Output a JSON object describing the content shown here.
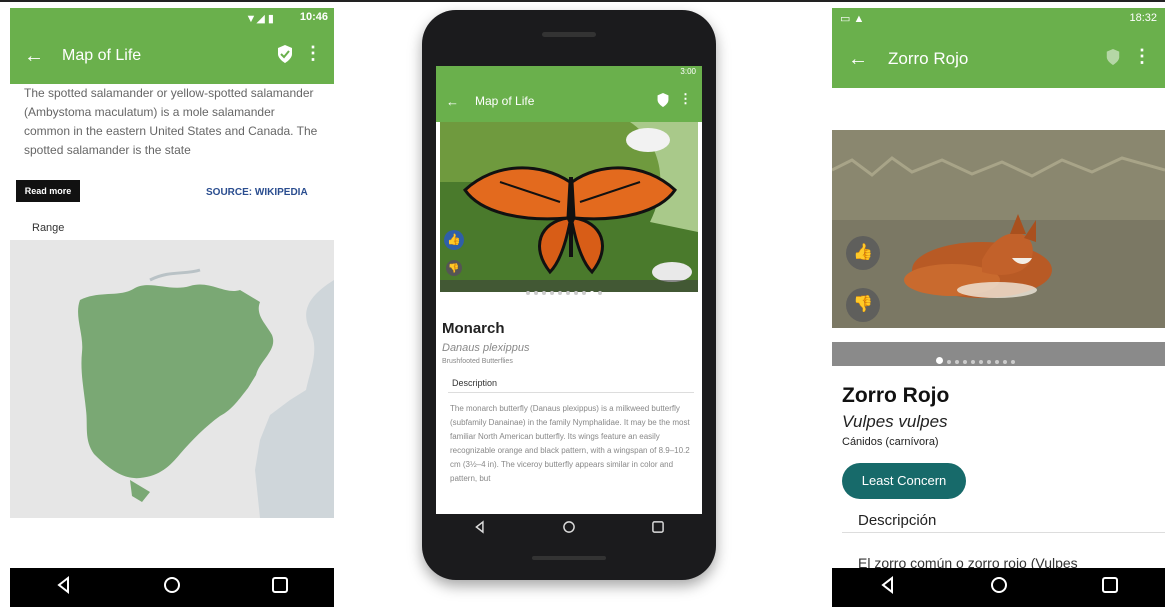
{
  "colors": {
    "green": "#6ab04c",
    "teal": "#176a6a",
    "map_land": "#e3e3e3",
    "map_water": "#cfd6da",
    "range": "#7aa874"
  },
  "left": {
    "status_time": "10:46",
    "title": "Map of Life",
    "description": "The spotted salamander or yellow-spotted salamander (Ambystoma maculatum) is a mole salamander common in the eastern United States and Canada. The spotted salamander is the state",
    "read_more": "Read more",
    "source": "SOURCE: WIKIPEDIA",
    "range_label": "Range",
    "icons": [
      "back-arrow-icon",
      "shield-check-icon",
      "more-vert-icon",
      "nav-back-icon",
      "nav-home-icon",
      "nav-recents-icon"
    ]
  },
  "middle": {
    "status_time": "3:00",
    "title": "Map of Life",
    "species_name": "Monarch",
    "scientific_name": "Danaus plexippus",
    "family": "Brushfooted Butterflies",
    "description_heading": "Description",
    "description": "The monarch butterfly (Danaus plexippus) is a milkweed butterfly (subfamily Danainae) in the family Nymphalidae. It may be the most familiar North American butterfly. Its wings feature an easily recognizable orange and black pattern, with a wingspan of 8.9–10.2 cm (3½–4 in). The viceroy butterfly appears similar in color and pattern, but",
    "icons": [
      "thumbs-up-icon",
      "thumbs-down-icon"
    ]
  },
  "right": {
    "status_time": "18:32",
    "title": "Zorro Rojo",
    "species_name": "Zorro Rojo",
    "scientific_name": "Vulpes vulpes",
    "family": "Cánidos (carnívora)",
    "status_button": "Least Concern",
    "description_heading": "Descripción",
    "description": "El zorro común o zorro rojo (Vulpes"
  }
}
